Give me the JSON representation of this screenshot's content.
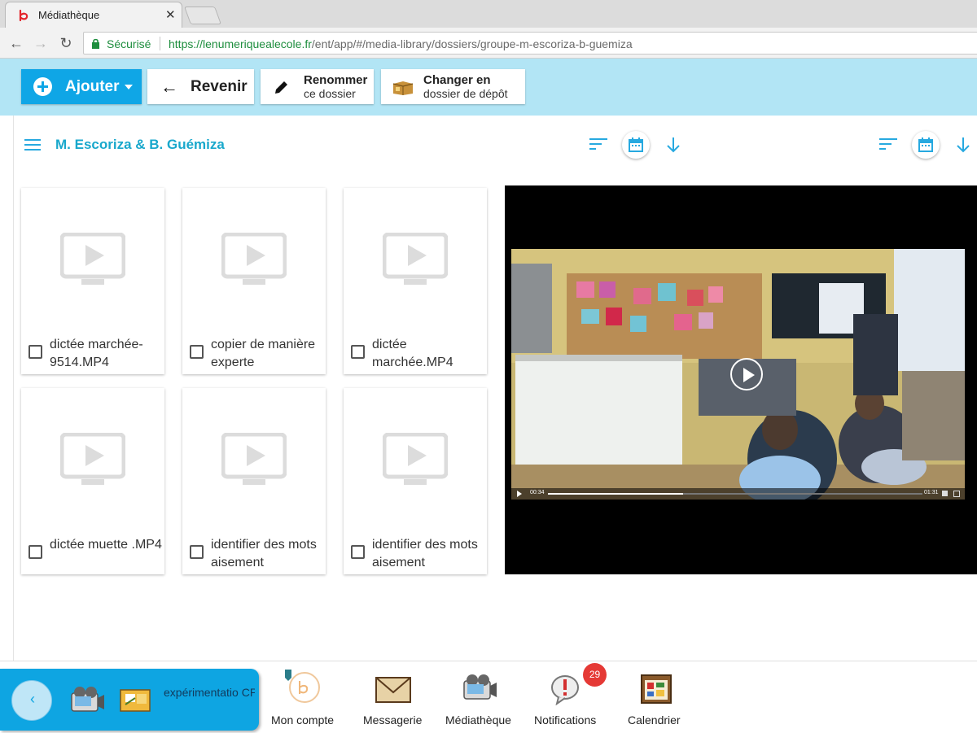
{
  "browser": {
    "tab_title": "Médiathèque",
    "tab_close": "✕",
    "secure_label": "Sécurisé",
    "url_scheme": "https://",
    "url_host": "lenumeriquealecole.fr",
    "url_path": "/ent/app/#/media-library/dossiers/groupe-m-escoriza-b-guemiza"
  },
  "toolbar": {
    "add_label": "Ajouter",
    "back_label": "Revenir",
    "rename_line1": "Renommer",
    "rename_line2": "ce dossier",
    "change_line1": "Changer en",
    "change_line2": "dossier de dépôt"
  },
  "folder": {
    "title": "M. Escoriza & B. Guémiza"
  },
  "media": [
    {
      "name": "dictée marchée-9514.MP4"
    },
    {
      "name": "copier de manière experte"
    },
    {
      "name": "dictée marchée.MP4"
    },
    {
      "name": "dictée muette .MP4"
    },
    {
      "name": "identifier des mots aisement"
    },
    {
      "name": "identifier des mots aisement"
    }
  ],
  "video": {
    "current_time": "00:34",
    "duration": "01:31",
    "progress": 0.36
  },
  "dock": {
    "back_icon": "chevron-left-icon",
    "project_label": "expérimentatio CP dédoublés",
    "items": [
      {
        "label": "Mon compte",
        "icon": "account-icon"
      },
      {
        "label": "Messagerie",
        "icon": "envelope-icon"
      },
      {
        "label": "Médiathèque",
        "icon": "media-library-icon"
      },
      {
        "label": "Notifications",
        "icon": "notification-icon"
      },
      {
        "label": "Calendrier",
        "icon": "calendar-icon"
      }
    ],
    "notification_count": "29"
  },
  "colors": {
    "accent": "#0fa6e6",
    "header_bg": "#b2e5f5",
    "title_color": "#19a8cc",
    "badge": "#e53935"
  }
}
